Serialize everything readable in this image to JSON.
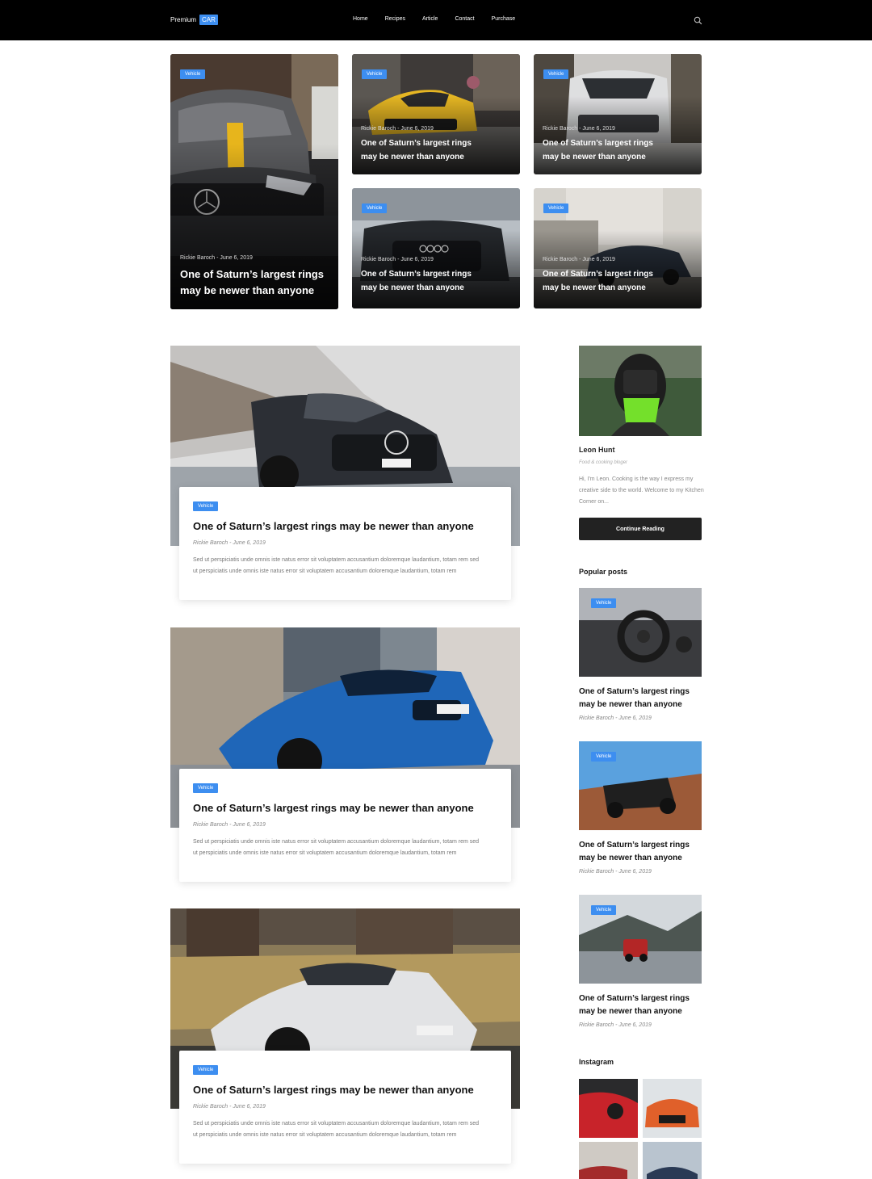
{
  "header": {
    "logo_text": "Premium",
    "logo_badge": "CAR",
    "nav": [
      "Home",
      "Recipes",
      "Article",
      "Contact",
      "Purchase"
    ]
  },
  "hero": {
    "tag": "Vehicle",
    "meta": "Rickie Baroch - June 6, 2019",
    "title_line1": "One of Saturn’s largest rings",
    "title_line2": "may be newer than anyone"
  },
  "posts": {
    "tag": "Vehicle",
    "title": "One of Saturn’s largest rings may be newer than anyone",
    "meta": "Rickie Baroch - June 6, 2019",
    "excerpt": "Sed ut perspiciatis unde omnis iste natus error sit voluptatem accusantium doloremque laudantium, totam rem sed ut perspiciatis unde omnis iste natus error sit voluptatem accusantium doloremque laudantium, totam rem"
  },
  "author": {
    "name": "Leon Hunt",
    "role": "Food & cooking bloger",
    "bio": "Hi, I'm Leon. Cooking is the way I express my creative side to the world. Welcome to my Kitchen Corner on...",
    "button": "Continue Reading"
  },
  "popular": {
    "heading": "Popular posts",
    "tag": "Vehicle",
    "title_line1": "One of Saturn’s largest rings",
    "title_line2": "may be newer than anyone",
    "meta": "Rickie Baroch - June 6, 2019"
  },
  "instagram": {
    "heading": "Instagram"
  },
  "colors": {
    "accent": "#3d8ef0",
    "header_bg": "#000000",
    "button_bg": "#222222"
  }
}
